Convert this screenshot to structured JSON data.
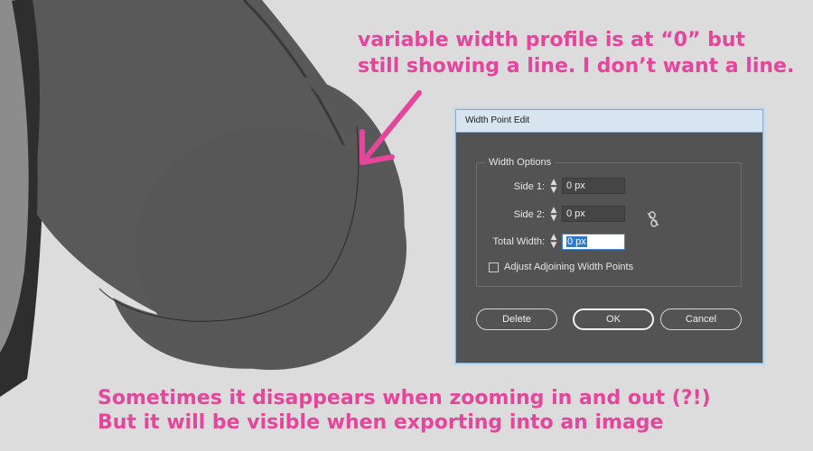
{
  "annotations": {
    "top": {
      "line1": "variable width profile is at “0” but",
      "line2": "still showing a line. I don’t want a line."
    },
    "bottom": {
      "line1": "Sometimes it disappears when zooming in and out (?!)",
      "line2": "But it will be visible when exporting into an image"
    }
  },
  "dialog": {
    "title": "Width Point Edit",
    "group_label": "Width Options",
    "side1": {
      "label": "Side 1:",
      "value": "0 px"
    },
    "side2": {
      "label": "Side 2:",
      "value": "0 px"
    },
    "total": {
      "label": "Total Width:",
      "value": "0 px"
    },
    "adjust_checkbox": {
      "label": "Adjust Adjoining Width Points",
      "checked": false
    },
    "buttons": {
      "delete": "Delete",
      "ok": "OK",
      "cancel": "Cancel"
    }
  },
  "colors": {
    "annotation": "#e3469b",
    "dialog_bg": "#535353",
    "shape_dark": "#5a5a5a",
    "shape_light": "#8a8a8a"
  },
  "icons": {
    "link": "broken-chain-link-icon",
    "arrow": "pink-arrow-annotation"
  }
}
